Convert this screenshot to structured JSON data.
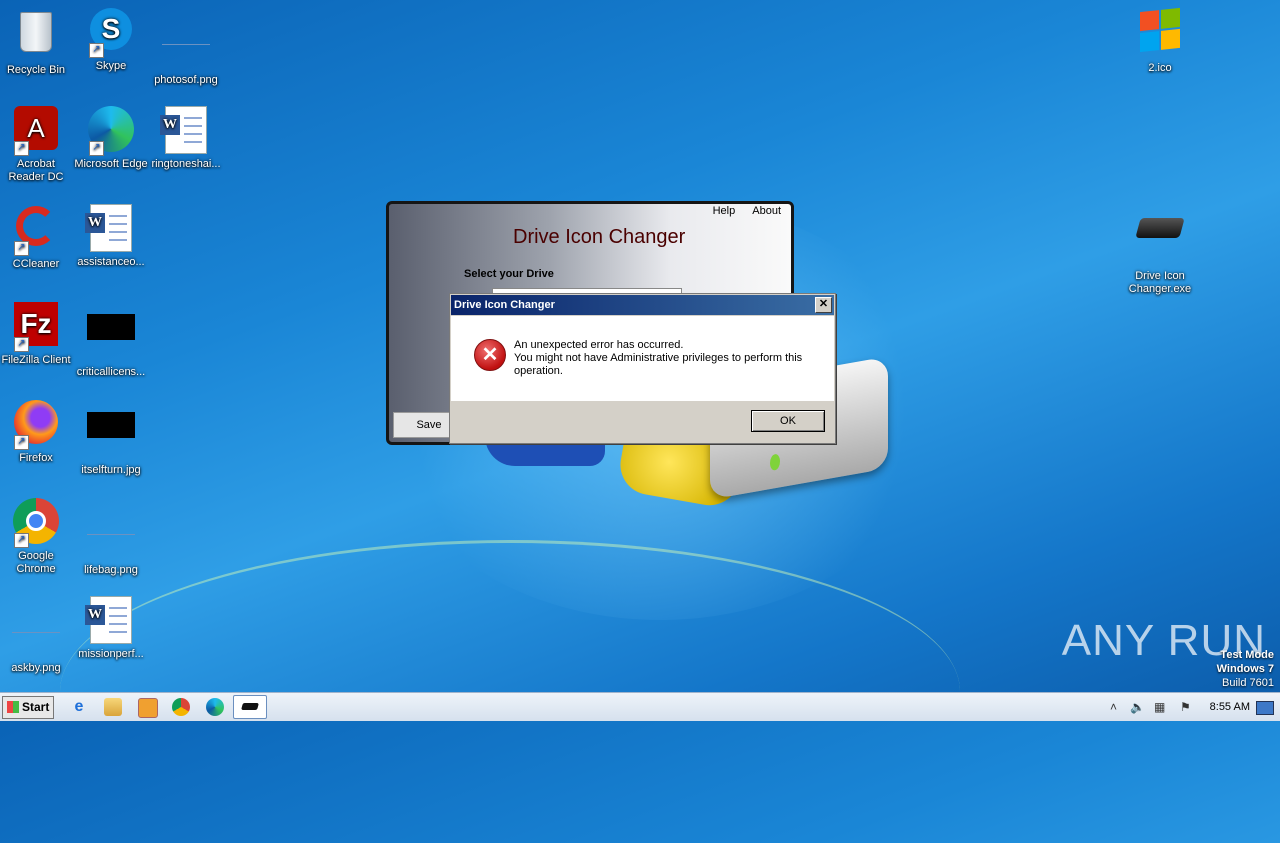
{
  "desktop": {
    "icons": [
      {
        "label": "Recycle Bin",
        "icon": "recycle-bin-icon"
      },
      {
        "label": "Skype",
        "icon": "skype-icon"
      },
      {
        "label": "photosof.png",
        "icon": "image-file-icon"
      },
      {
        "label": "Acrobat Reader DC",
        "icon": "acrobat-icon"
      },
      {
        "label": "Microsoft Edge",
        "icon": "edge-icon"
      },
      {
        "label": "ringtoneshai...",
        "icon": "word-doc-icon"
      },
      {
        "label": "CCleaner",
        "icon": "ccleaner-icon"
      },
      {
        "label": "assistanceo...",
        "icon": "word-doc-icon"
      },
      {
        "label": "FileZilla Client",
        "icon": "filezilla-icon"
      },
      {
        "label": "criticallicens...",
        "icon": "image-file-icon"
      },
      {
        "label": "Firefox",
        "icon": "firefox-icon"
      },
      {
        "label": "itselfturn.jpg",
        "icon": "image-file-icon"
      },
      {
        "label": "Google Chrome",
        "icon": "chrome-icon"
      },
      {
        "label": "lifebag.png",
        "icon": "image-file-icon"
      },
      {
        "label": "askby.png",
        "icon": "image-file-icon"
      },
      {
        "label": "missionperf...",
        "icon": "word-doc-icon"
      },
      {
        "label": "2.ico",
        "icon": "windows-logo-icon"
      },
      {
        "label": "Drive Icon Changer.exe",
        "icon": "drive-icon"
      }
    ]
  },
  "app": {
    "menu_help": "Help",
    "menu_about": "About",
    "title": "Drive Icon Changer",
    "select_label": "Select your Drive",
    "save_label": "Save"
  },
  "dialog": {
    "title": "Drive Icon Changer",
    "close_glyph": "✕",
    "line1": "An unexpected error has occurred.",
    "line2": "You might not have Administrative privileges to perform this",
    "line3": "operation.",
    "ok_label": "OK"
  },
  "taskbar": {
    "start_label": "Start",
    "clock": "8:55 AM",
    "pinned": [
      "internet-explorer-icon",
      "explorer-icon",
      "media-player-icon",
      "chrome-icon",
      "edge-icon",
      "drive-icon-changer-icon"
    ]
  },
  "watermark": "ANY RUN",
  "testmode": {
    "line1": "Test Mode",
    "line2": "Windows 7",
    "line3": "Build 7601"
  },
  "colors": {
    "desktop": "#1a86d6",
    "title_text": "#4a0000",
    "dialog_titlebar": "#0a246a",
    "error": "#c01010"
  }
}
